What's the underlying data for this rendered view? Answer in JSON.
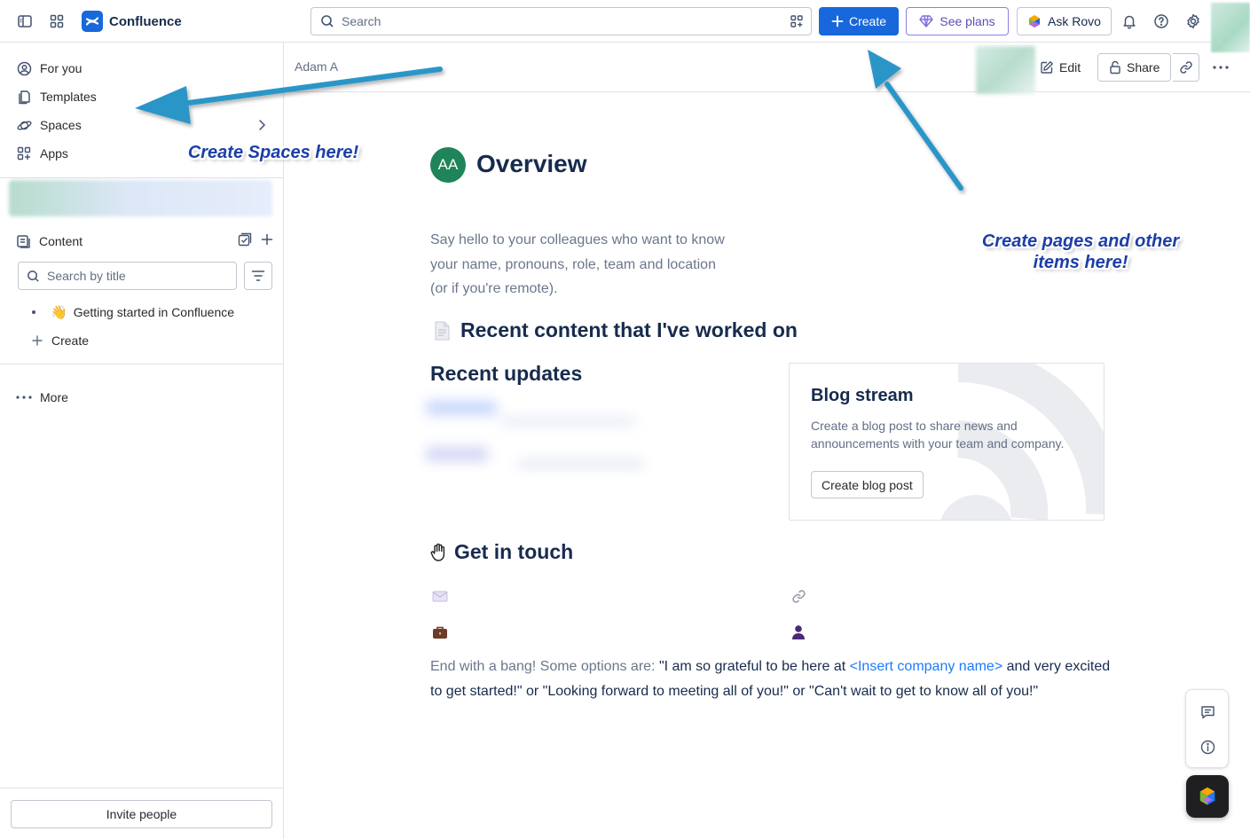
{
  "topbar": {
    "app_name": "Confluence",
    "search_placeholder": "Search",
    "create_label": "Create",
    "plans_label": "See plans",
    "rovo_label": "Ask Rovo"
  },
  "sidebar": {
    "nav": [
      {
        "label": "For you",
        "icon": "person-circle-icon"
      },
      {
        "label": "Templates",
        "icon": "templates-icon"
      },
      {
        "label": "Spaces",
        "icon": "planet-icon"
      },
      {
        "label": "Apps",
        "icon": "apps-icon"
      }
    ],
    "content_label": "Content",
    "title_search_placeholder": "Search by title",
    "tree_items": [
      {
        "label": "Getting started in Confluence",
        "emoji": "👋"
      }
    ],
    "create_label": "Create",
    "more_label": "More",
    "invite_label": "Invite people"
  },
  "breadcrumb": {
    "owner": "Adam A"
  },
  "page_actions": {
    "edit_label": "Edit",
    "share_label": "Share"
  },
  "page": {
    "avatar_initials": "AA",
    "title": "Overview",
    "intro_lines": [
      "Say hello to your colleagues who want to know",
      "your name, pronouns, role, team and location",
      "(or if you're remote)."
    ],
    "recent_heading": "Recent content that I've worked on",
    "updates_heading": "Recent updates",
    "blog": {
      "title": "Blog stream",
      "description": "Create a blog post to share news and announcements with your team and company.",
      "button": "Create blog post"
    },
    "touch_heading": "Get in touch",
    "closing": {
      "muted": "End with a bang! Some options are: ",
      "quote1": "\"I am so grateful to be here at ",
      "placeholder": "<Insert company name>",
      "rest": " and very excited to get started!\" or \"Looking forward to meeting all of you!\" or \"Can't wait to get to know all of you!\""
    }
  },
  "annotations": {
    "spaces": "Create Spaces here!",
    "pages_line1": "Create pages and other",
    "pages_line2": "items here!"
  },
  "colors": {
    "brand_blue": "#1868db",
    "annotation_arrow": "#2a96c8",
    "annotation_text": "#1c3ea8",
    "avatar_green": "#1f845a"
  }
}
